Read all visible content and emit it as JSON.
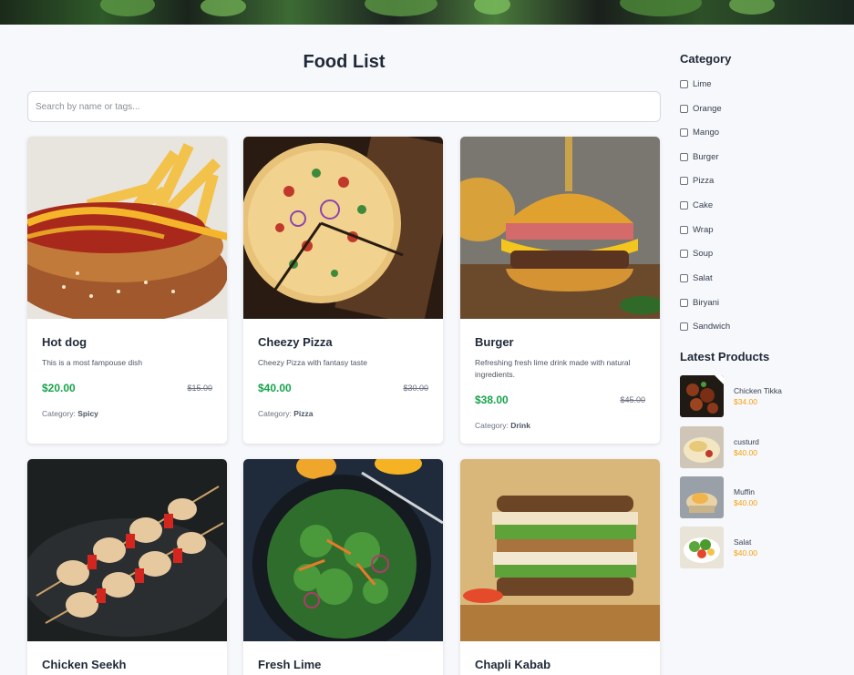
{
  "main": {
    "title": "Food List",
    "search_placeholder": "Search by name or tags..."
  },
  "cards": [
    {
      "title": "Hot dog",
      "desc": "This is a most fampouse dish",
      "price": "$20.00",
      "old_price": "$15.00",
      "category_label": "Category:",
      "category": "Spicy"
    },
    {
      "title": "Cheezy Pizza",
      "desc": "Cheezy Pizza with fantasy taste",
      "price": "$40.00",
      "old_price": "$30.00",
      "category_label": "Category:",
      "category": "Pizza"
    },
    {
      "title": "Burger",
      "desc": "Refreshing fresh lime drink made with natural ingredients.",
      "price": "$38.00",
      "old_price": "$45.00",
      "category_label": "Category:",
      "category": "Drink"
    },
    {
      "title": "Chicken Seekh"
    },
    {
      "title": "Fresh Lime"
    },
    {
      "title": "Chapli Kabab"
    }
  ],
  "sidebar": {
    "category_heading": "Category",
    "categories": [
      "Lime",
      "Orange",
      "Mango",
      "Burger",
      "Pizza",
      "Cake",
      "Wrap",
      "Soup",
      "Salat",
      "Biryani",
      "Sandwich"
    ],
    "latest_heading": "Latest Products",
    "latest": [
      {
        "name": "Chicken Tikka",
        "price": "$34.00"
      },
      {
        "name": "custurd",
        "price": "$40.00"
      },
      {
        "name": "Muffin",
        "price": "$40.00"
      },
      {
        "name": "Salat",
        "price": "$40.00"
      }
    ]
  },
  "colors": {
    "price_green": "#16a34a",
    "latest_price_orange": "#f59e0b",
    "page_background": "#f7f8fb"
  }
}
